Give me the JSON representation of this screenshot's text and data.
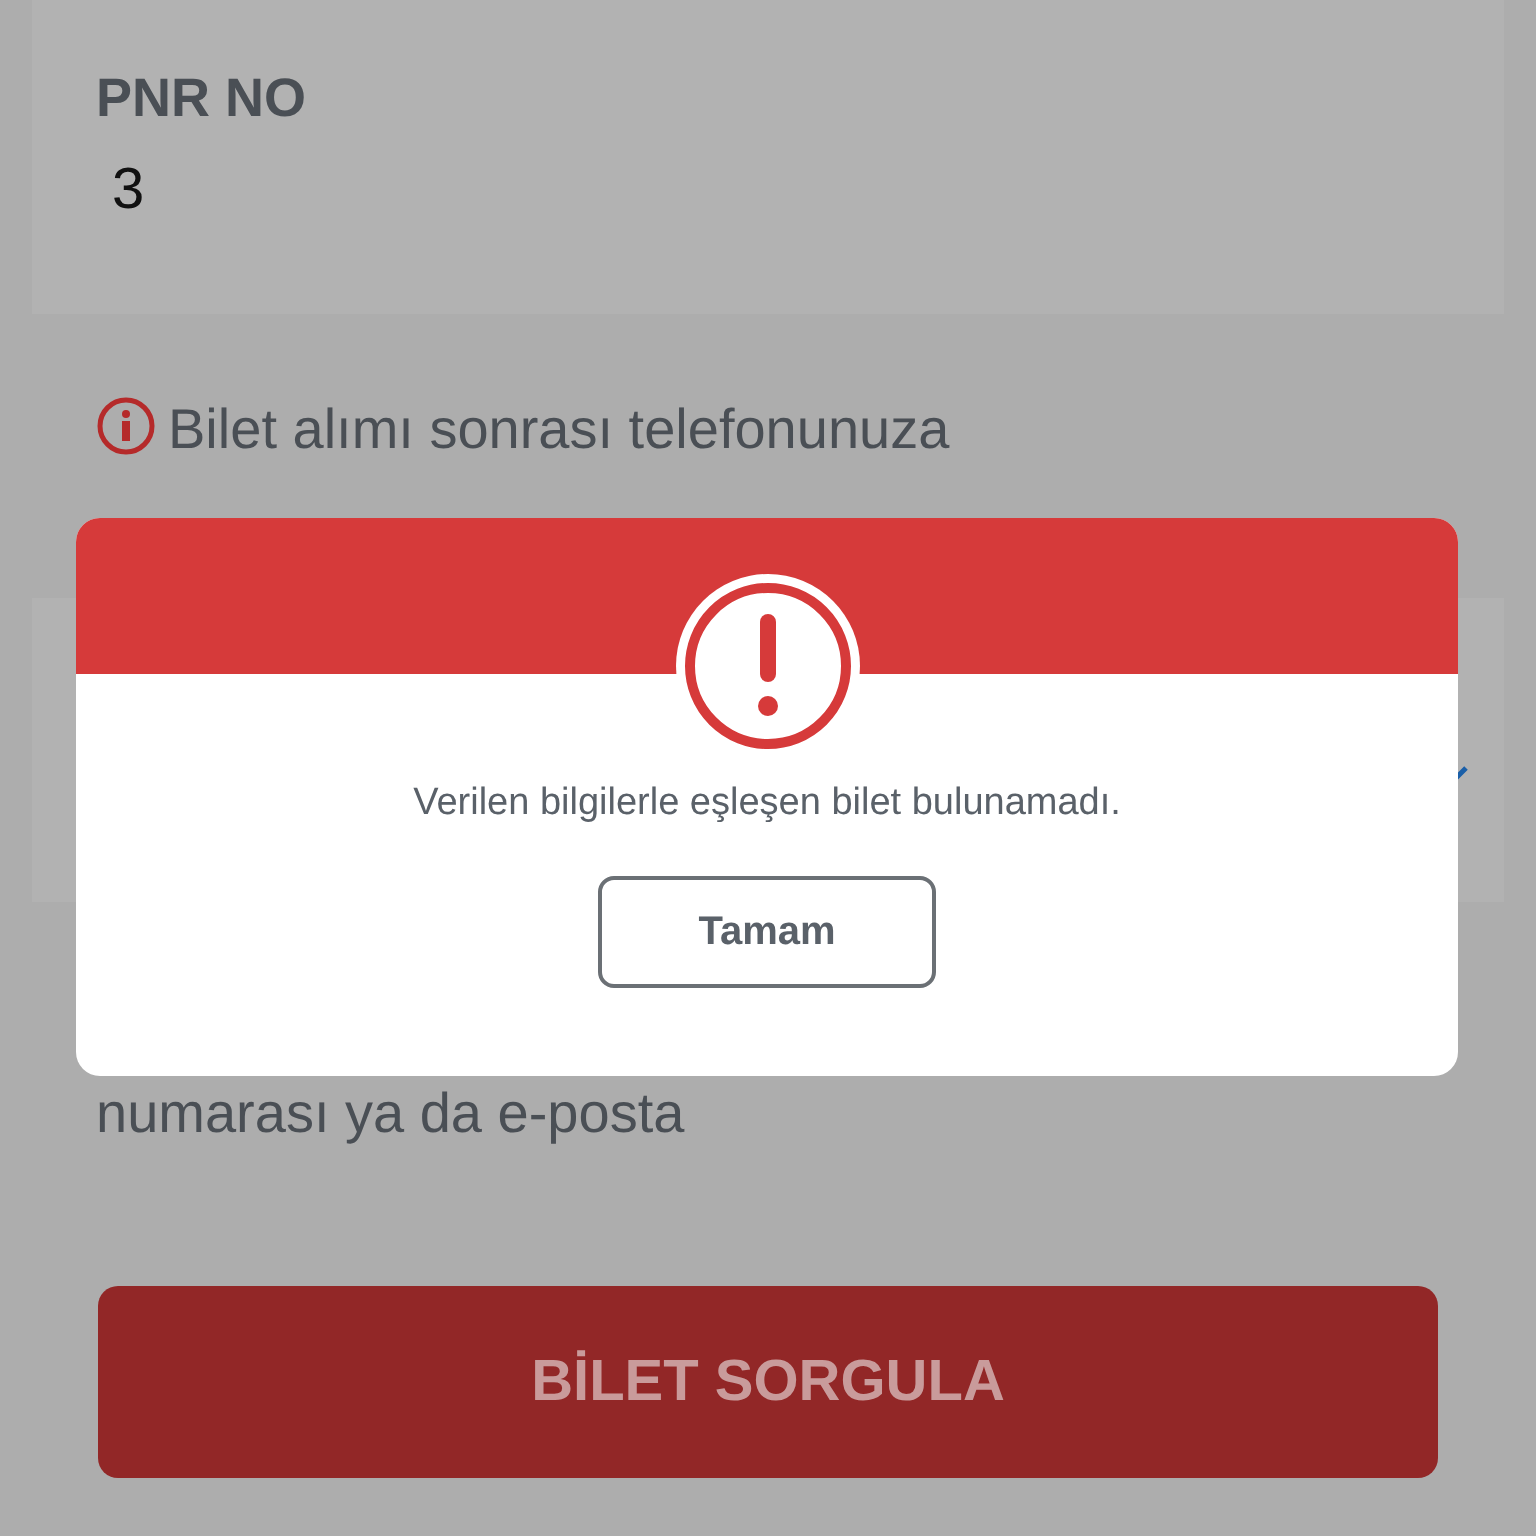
{
  "pnr_field": {
    "label": "PNR NO",
    "value": "3"
  },
  "note": {
    "text": "Bilet alımı sonrası telefonunuza"
  },
  "second_note": {
    "text": "numarası ya da e-posta"
  },
  "query_button": {
    "label": "BİLET SORGULA"
  },
  "dialog": {
    "message": "Verilen bilgilerle eşleşen bilet bulunamadı.",
    "button": "Tamam"
  }
}
